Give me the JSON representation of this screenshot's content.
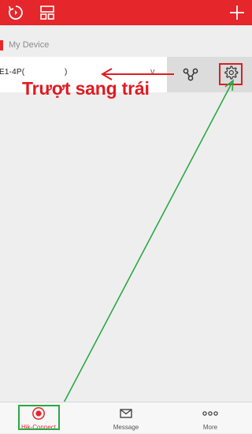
{
  "header": {
    "icons": [
      "refresh-clock-icon",
      "layout-grid-icon",
      "add-icon"
    ],
    "background": "#e5262b"
  },
  "section": {
    "title": "My Device"
  },
  "device": {
    "name": "E1-4P(",
    "name_tail": ")",
    "caret": "v",
    "actions": [
      "share-icon",
      "gear-icon"
    ]
  },
  "annotation": {
    "text": "Trượt sang trái",
    "text_color": "#e01b22",
    "arrow_color": "#e01b22",
    "pointer_color": "#2aa845"
  },
  "nav": {
    "items": [
      {
        "label": "Hik-Connect",
        "icon": "hik-connect-icon",
        "active": true
      },
      {
        "label": "Message",
        "icon": "mail-icon",
        "active": false
      },
      {
        "label": "More",
        "icon": "more-dots-icon",
        "active": false
      }
    ]
  }
}
